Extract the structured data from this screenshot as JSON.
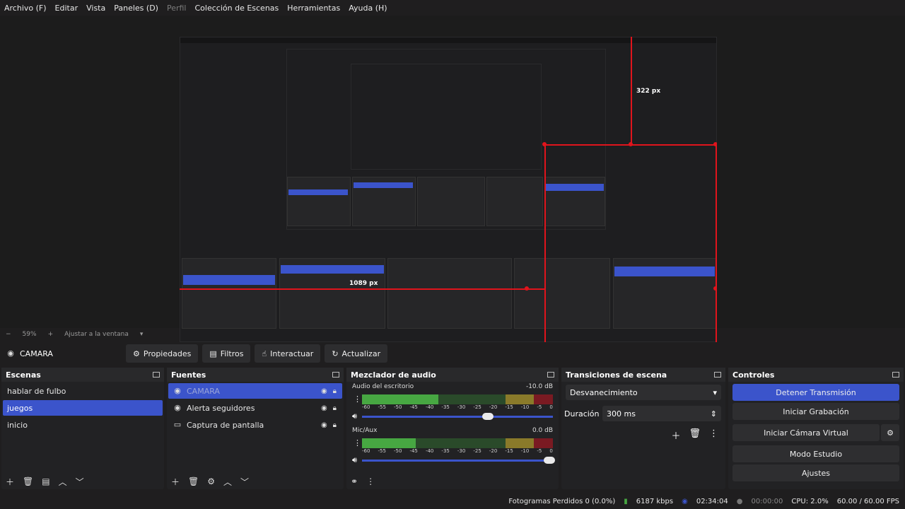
{
  "menu": {
    "items": [
      "Archivo (F)",
      "Editar",
      "Vista",
      "Paneles (D)",
      "Perfil",
      "Colección de Escenas",
      "Herramientas",
      "Ayuda (H)"
    ]
  },
  "preview": {
    "measure_322": "322 px",
    "measure_1089": "1089 px"
  },
  "zoom": {
    "minus": "−",
    "value": "59%",
    "plus": "+",
    "fit": "Ajustar a la ventana"
  },
  "source_toolbar": {
    "source_name": "CAMARA",
    "properties": "Propiedades",
    "filters": "Filtros",
    "interact": "Interactuar",
    "refresh": "Actualizar"
  },
  "scenes": {
    "title": "Escenas",
    "items": [
      "hablar de fulbo",
      "juegos",
      "inicio"
    ]
  },
  "sources": {
    "title": "Fuentes",
    "items": [
      "CAMARA",
      "Alerta seguidores",
      "Captura de pantalla"
    ]
  },
  "mixer": {
    "title": "Mezclador de audio",
    "ticks": [
      "-60",
      "-55",
      "-50",
      "-45",
      "-40",
      "-35",
      "-30",
      "-25",
      "-20",
      "-15",
      "-10",
      "-5",
      "0"
    ],
    "tracks": [
      {
        "name": "Audio del escritorio",
        "db": "-10.0 dB",
        "level": 0.4,
        "volume": 0.66
      },
      {
        "name": "Mic/Aux",
        "db": "0.0 dB",
        "level": 0.28,
        "volume": 0.98
      }
    ]
  },
  "transitions": {
    "title": "Transiciones de escena",
    "selected": "Desvanecimiento",
    "duration_label": "Duración",
    "duration_value": "300 ms"
  },
  "controls": {
    "title": "Controles",
    "stop_stream": "Detener Transmisión",
    "start_recording": "Iniciar Grabación",
    "start_vcam": "Iniciar Cámara Virtual",
    "studio_mode": "Modo Estudio",
    "settings": "Ajustes"
  },
  "status": {
    "dropped": "Fotogramas Perdidos 0 (0.0%)",
    "bitrate": "6187 kbps",
    "stream_time": "02:34:04",
    "rec_time": "00:00:00",
    "cpu": "CPU: 2.0%",
    "fps": "60.00 / 60.00 FPS"
  },
  "colors": {
    "accent": "#3b54cb",
    "red_guides": "#e0141c"
  }
}
